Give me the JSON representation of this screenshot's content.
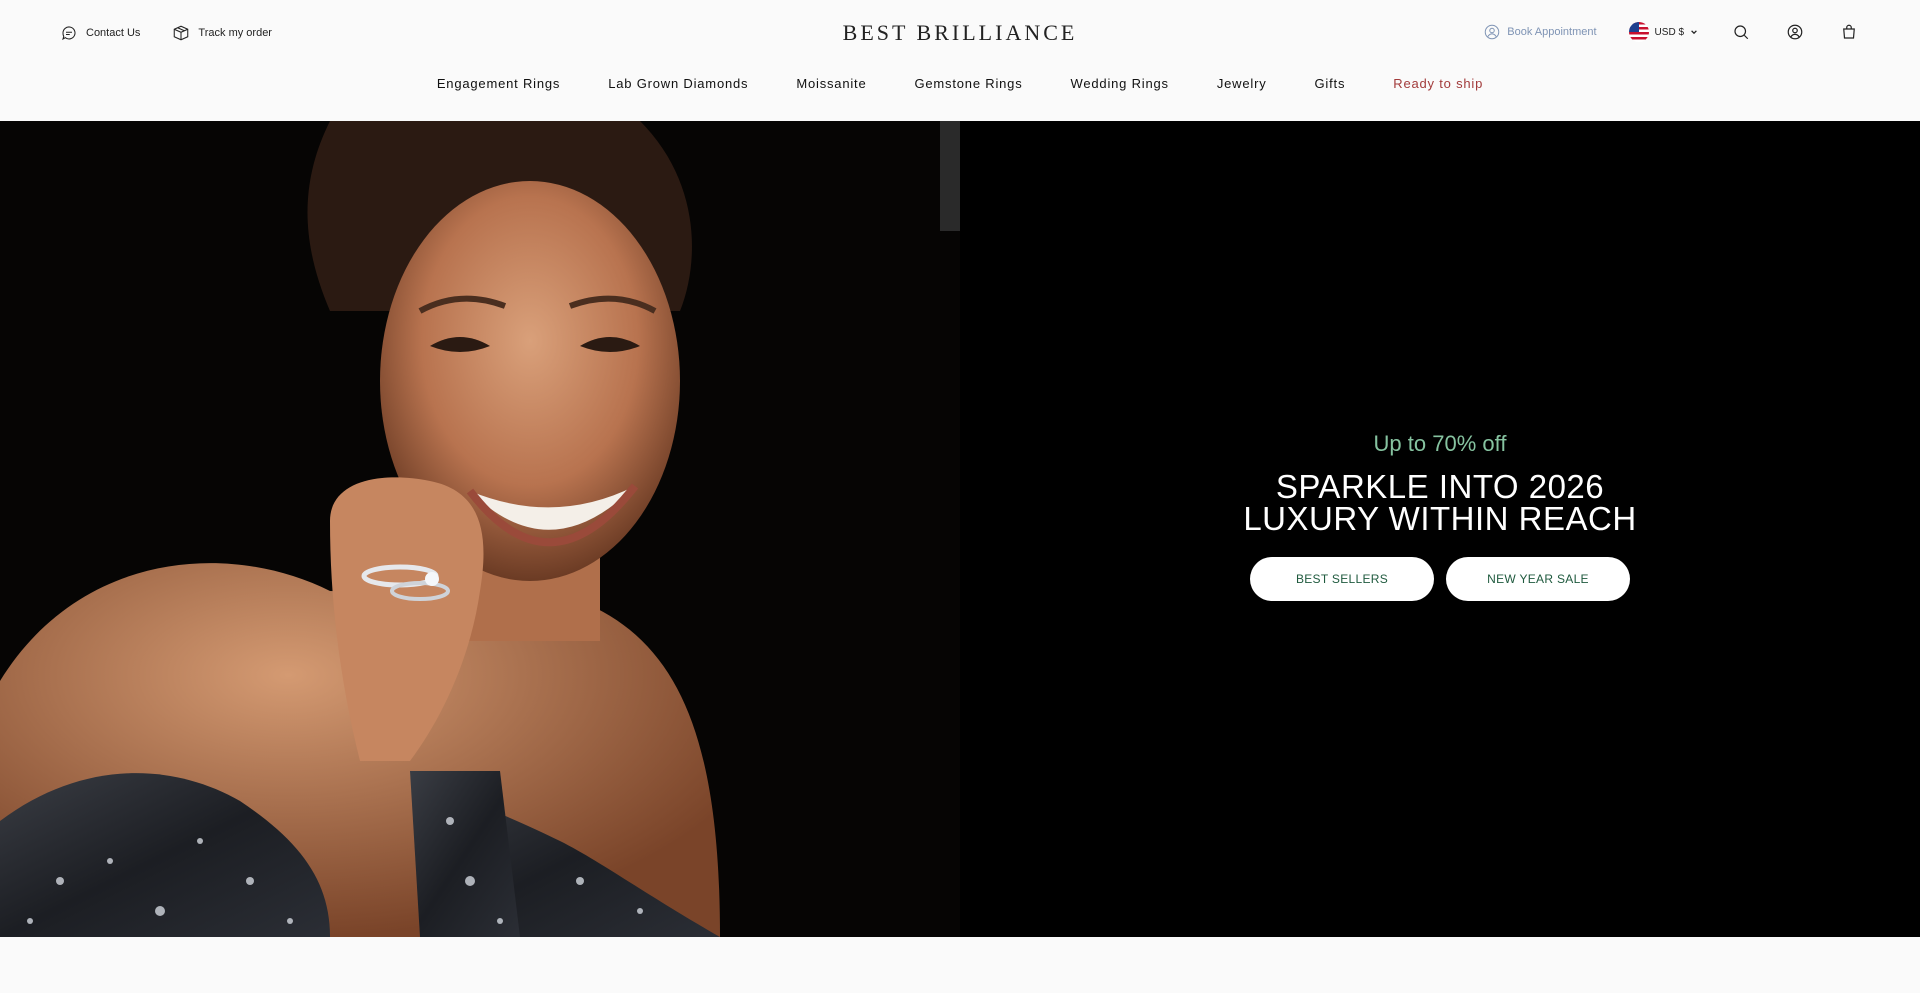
{
  "header": {
    "contact_label": "Contact Us",
    "track_label": "Track my order",
    "logo": "BEST BRILLIANCE",
    "book_label": "Book Appointment",
    "currency_label": "USD $"
  },
  "nav": {
    "items": [
      {
        "label": "Engagement Rings"
      },
      {
        "label": "Lab Grown Diamonds"
      },
      {
        "label": "Moissanite"
      },
      {
        "label": "Gemstone Rings"
      },
      {
        "label": "Wedding Rings"
      },
      {
        "label": "Jewelry"
      },
      {
        "label": "Gifts"
      },
      {
        "label": "Ready to ship"
      }
    ]
  },
  "hero": {
    "eyebrow": "Up to 70% off",
    "headline_line1": "SPARKLE INTO 2026",
    "headline_line2": "LUXURY WITHIN REACH",
    "buttons": [
      {
        "label": "BEST SELLERS"
      },
      {
        "label": "NEW YEAR SALE"
      }
    ]
  },
  "colors": {
    "accent_red": "#a23b3b",
    "accent_green": "#86c3a0",
    "button_text": "#1f5a3e",
    "book_blue": "#7e93b4"
  },
  "icons": [
    "chat-icon",
    "box-icon",
    "calendar-person-icon",
    "us-flag-icon",
    "chevron-down-icon",
    "search-icon",
    "account-icon",
    "bag-icon"
  ]
}
